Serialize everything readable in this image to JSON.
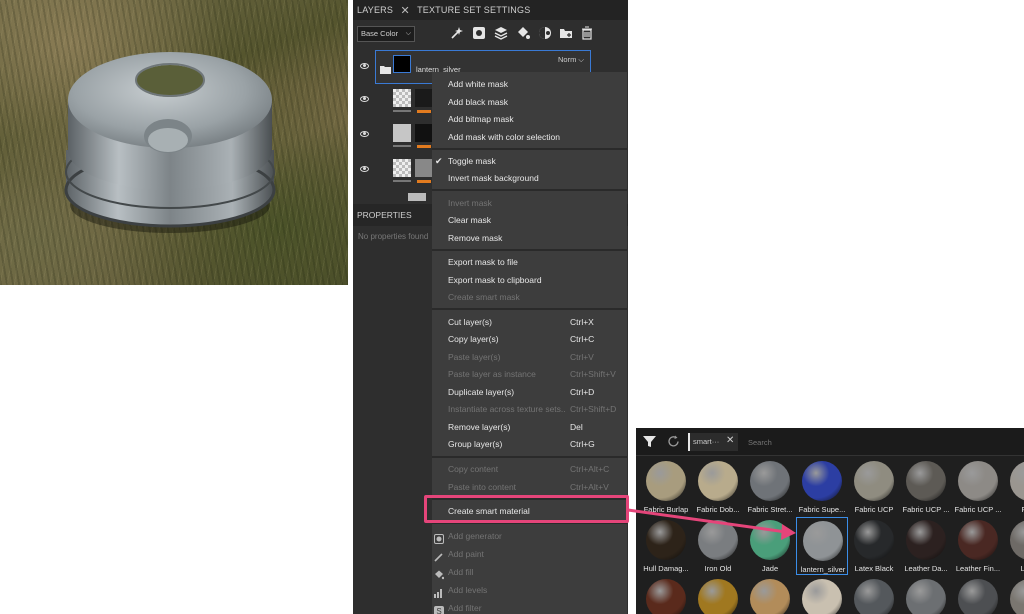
{
  "tabs": {
    "layers": "LAYERS",
    "texture_set_settings": "TEXTURE SET SETTINGS"
  },
  "channel_select": "Base Color",
  "group_layer": {
    "name": "lantern_silver",
    "blend_mode": "Norm"
  },
  "properties": {
    "title": "PROPERTIES",
    "empty_text": "No properties found"
  },
  "context_menu": {
    "add_white_mask": "Add white mask",
    "add_black_mask": "Add black mask",
    "add_bitmap_mask": "Add bitmap mask",
    "add_mask_color_selection": "Add mask with color selection",
    "toggle_mask": "Toggle mask",
    "invert_mask_background": "Invert mask background",
    "invert_mask": "Invert mask",
    "clear_mask": "Clear mask",
    "remove_mask": "Remove mask",
    "export_mask_file": "Export mask to file",
    "export_mask_clipboard": "Export mask to clipboard",
    "create_smart_mask": "Create smart mask",
    "cut_layers": "Cut layer(s)",
    "cut_shortcut": "Ctrl+X",
    "copy_layers": "Copy layer(s)",
    "copy_shortcut": "Ctrl+C",
    "paste_layers": "Paste layer(s)",
    "paste_shortcut": "Ctrl+V",
    "paste_instance": "Paste layer as instance",
    "paste_instance_shortcut": "Ctrl+Shift+V",
    "duplicate_layers": "Duplicate layer(s)",
    "duplicate_shortcut": "Ctrl+D",
    "instantiate": "Instantiate across texture sets...",
    "instantiate_shortcut": "Ctrl+Shift+D",
    "remove_layers": "Remove layer(s)",
    "remove_shortcut": "Del",
    "group_layers": "Group layer(s)",
    "group_shortcut": "Ctrl+G",
    "copy_content": "Copy content",
    "copy_content_shortcut": "Ctrl+Alt+C",
    "paste_content": "Paste into content",
    "paste_content_shortcut": "Ctrl+Alt+V",
    "create_smart_material": "Create smart material",
    "add_generator": "Add generator",
    "add_paint": "Add paint",
    "add_fill": "Add fill",
    "add_levels": "Add levels",
    "add_filter": "Add filter"
  },
  "shelf": {
    "filter_chip": "smart···",
    "search_placeholder": "Search",
    "row1": [
      "Fabric Burlap",
      "Fabric Dob...",
      "Fabric Stret...",
      "Fabric Supe...",
      "Fabric UCP",
      "Fabric UCP ...",
      "Fabric UCP ...",
      "Fabri"
    ],
    "row2": [
      "Hull Damag...",
      "Iron Old",
      "Jade",
      "lantern_silver",
      "Latex Black",
      "Leather Da...",
      "Leather Fin...",
      "Leath"
    ],
    "selected": "lantern_silver"
  },
  "colors": {
    "accent_highlight": "#e5457a",
    "selection_blue": "#3a7ad5",
    "mask_orange": "#e27b1f"
  }
}
